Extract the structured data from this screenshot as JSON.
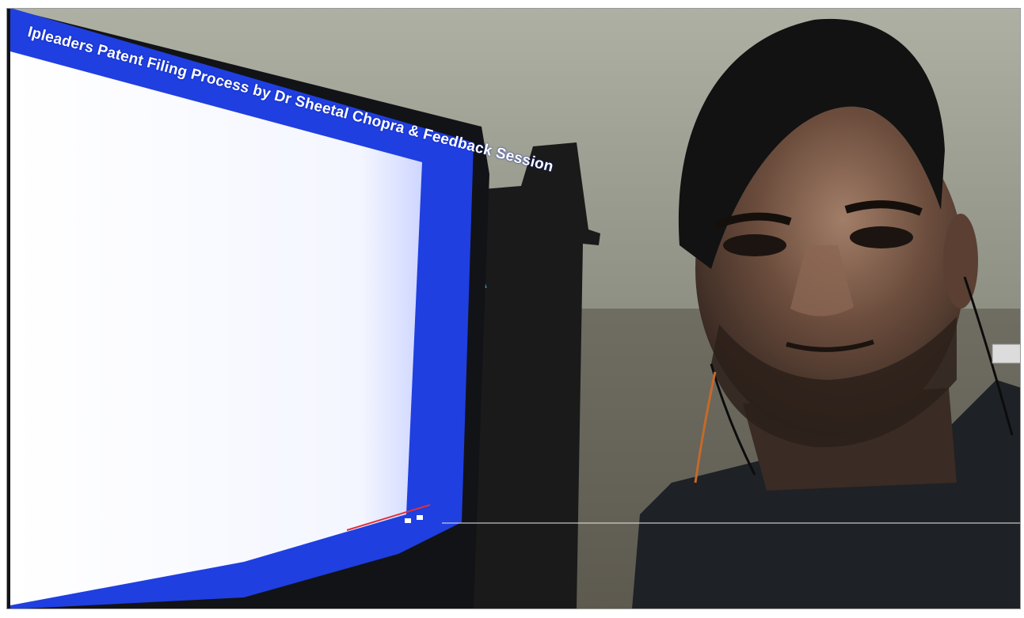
{
  "monitor": {
    "title": "Ipleaders Patent Filing Process by Dr Sheetal Chopra & Feedback Session"
  },
  "colors": {
    "screen_blue": "#1f3fe0",
    "screen_white": "#ffffff",
    "wall": "#a9ab9e",
    "shirt": "#1e2125",
    "skin": "#6b4a3b"
  },
  "icons": {
    "person": "person-photo",
    "monitor": "monitor-screen"
  }
}
